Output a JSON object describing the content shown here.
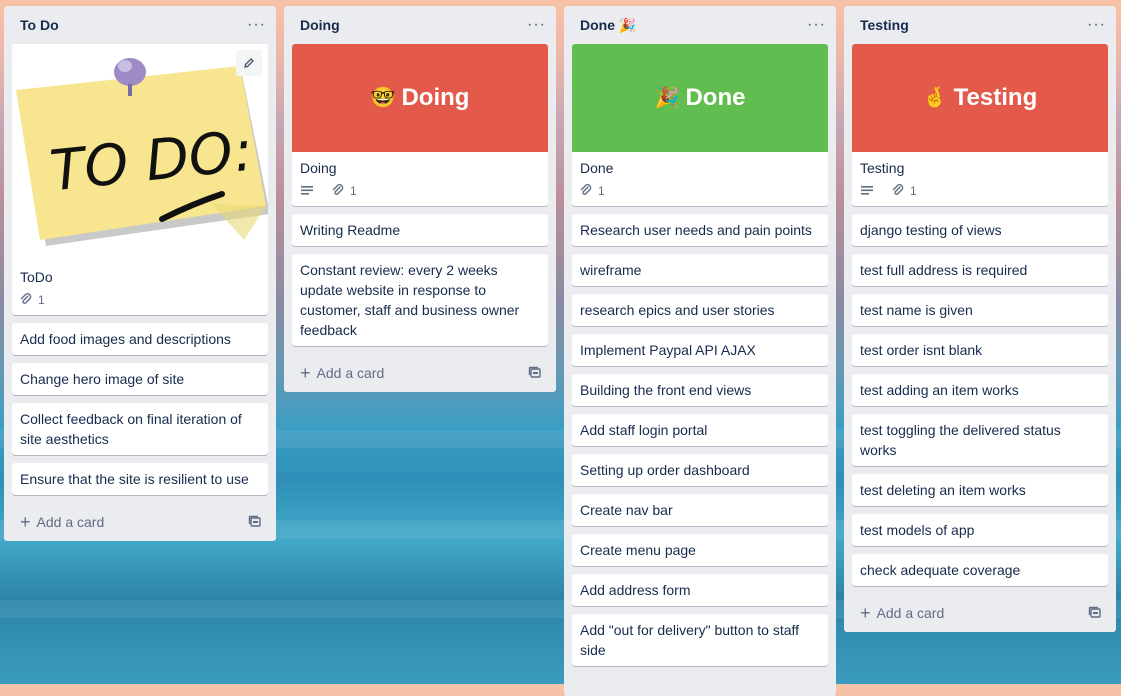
{
  "lists": [
    {
      "title": "To Do",
      "image_card": {
        "title": "ToDo",
        "attachments": "1",
        "image_text": "TO DO:"
      },
      "cards": [
        "Add food images and descriptions",
        "Change hero image of site",
        "Collect feedback on final iteration of site aesthetics",
        "Ensure that the site is resilient to use"
      ],
      "add_label": "Add a card"
    },
    {
      "title": "Doing",
      "cover": {
        "emoji": "🤓",
        "text": "Doing",
        "color": "#e3594a"
      },
      "cover_card": {
        "title": "Doing",
        "attachments": "1"
      },
      "cards": [
        "Writing Readme",
        "Constant review: every 2 weeks update website in response to customer, staff and business owner feedback"
      ],
      "add_label": "Add a card"
    },
    {
      "title": "Done",
      "title_emoji": "🎉",
      "cover": {
        "emoji": "🎉",
        "text": "Done",
        "color": "#61bd4f"
      },
      "cover_card": {
        "title": "Done",
        "attachments": "1"
      },
      "cards": [
        "Research user needs and pain points",
        "wireframe",
        "research epics and user stories",
        "Implement Paypal API AJAX",
        "Building the front end views",
        "Add staff login portal",
        "Setting up order dashboard",
        "Create nav bar",
        "Create menu page",
        "Add address form",
        "Add \"out for delivery\" button to staff side"
      ]
    },
    {
      "title": "Testing",
      "cover": {
        "emoji": "🤞",
        "text": "Testing",
        "color": "#e3594a"
      },
      "cover_card": {
        "title": "Testing",
        "attachments": "1"
      },
      "cards": [
        "django testing of views",
        "test full address is required",
        "test name is given",
        "test order isnt blank",
        "test adding an item works",
        "test toggling the delivered status works",
        "test deleting an item works",
        "test models of app",
        "check adequate coverage"
      ],
      "add_label": "Add a card"
    }
  ],
  "icons": {
    "menu": "ellipsis-icon",
    "attachment": "paperclip-icon",
    "description": "description-lines-icon",
    "template": "card-template-icon",
    "edit": "pencil-icon"
  }
}
